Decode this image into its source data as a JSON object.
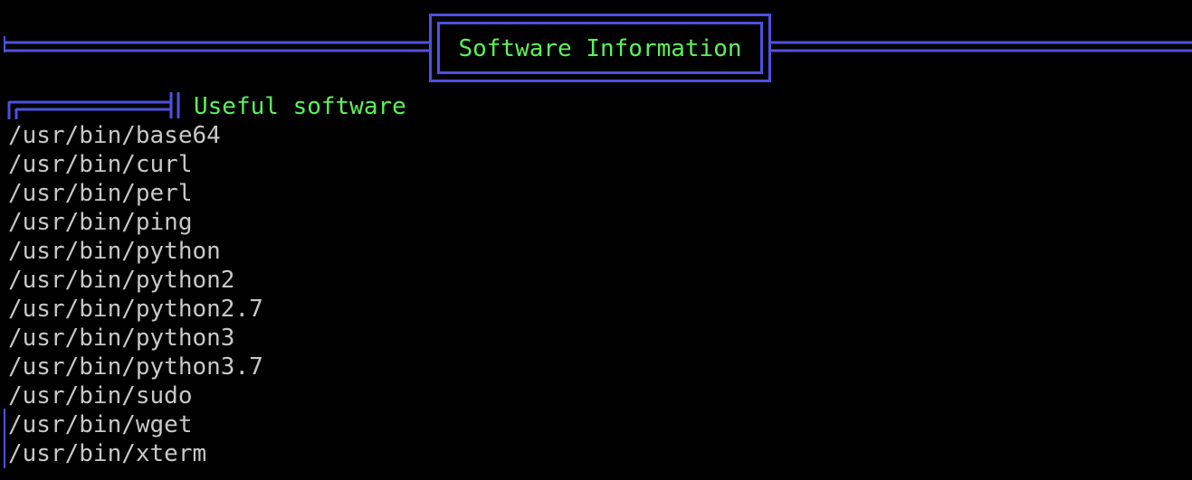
{
  "header": {
    "title": "Software Information"
  },
  "section": {
    "title": "Useful software"
  },
  "software": [
    "/usr/bin/base64",
    "/usr/bin/curl",
    "/usr/bin/perl",
    "/usr/bin/ping",
    "/usr/bin/python",
    "/usr/bin/python2",
    "/usr/bin/python2.7",
    "/usr/bin/python3",
    "/usr/bin/python3.7",
    "/usr/bin/sudo",
    "/usr/bin/wget",
    "/usr/bin/xterm"
  ],
  "colors": {
    "background": "#000000",
    "border": "#5050e0",
    "heading_text": "#5cf15c",
    "list_text": "#c8c8c8"
  }
}
